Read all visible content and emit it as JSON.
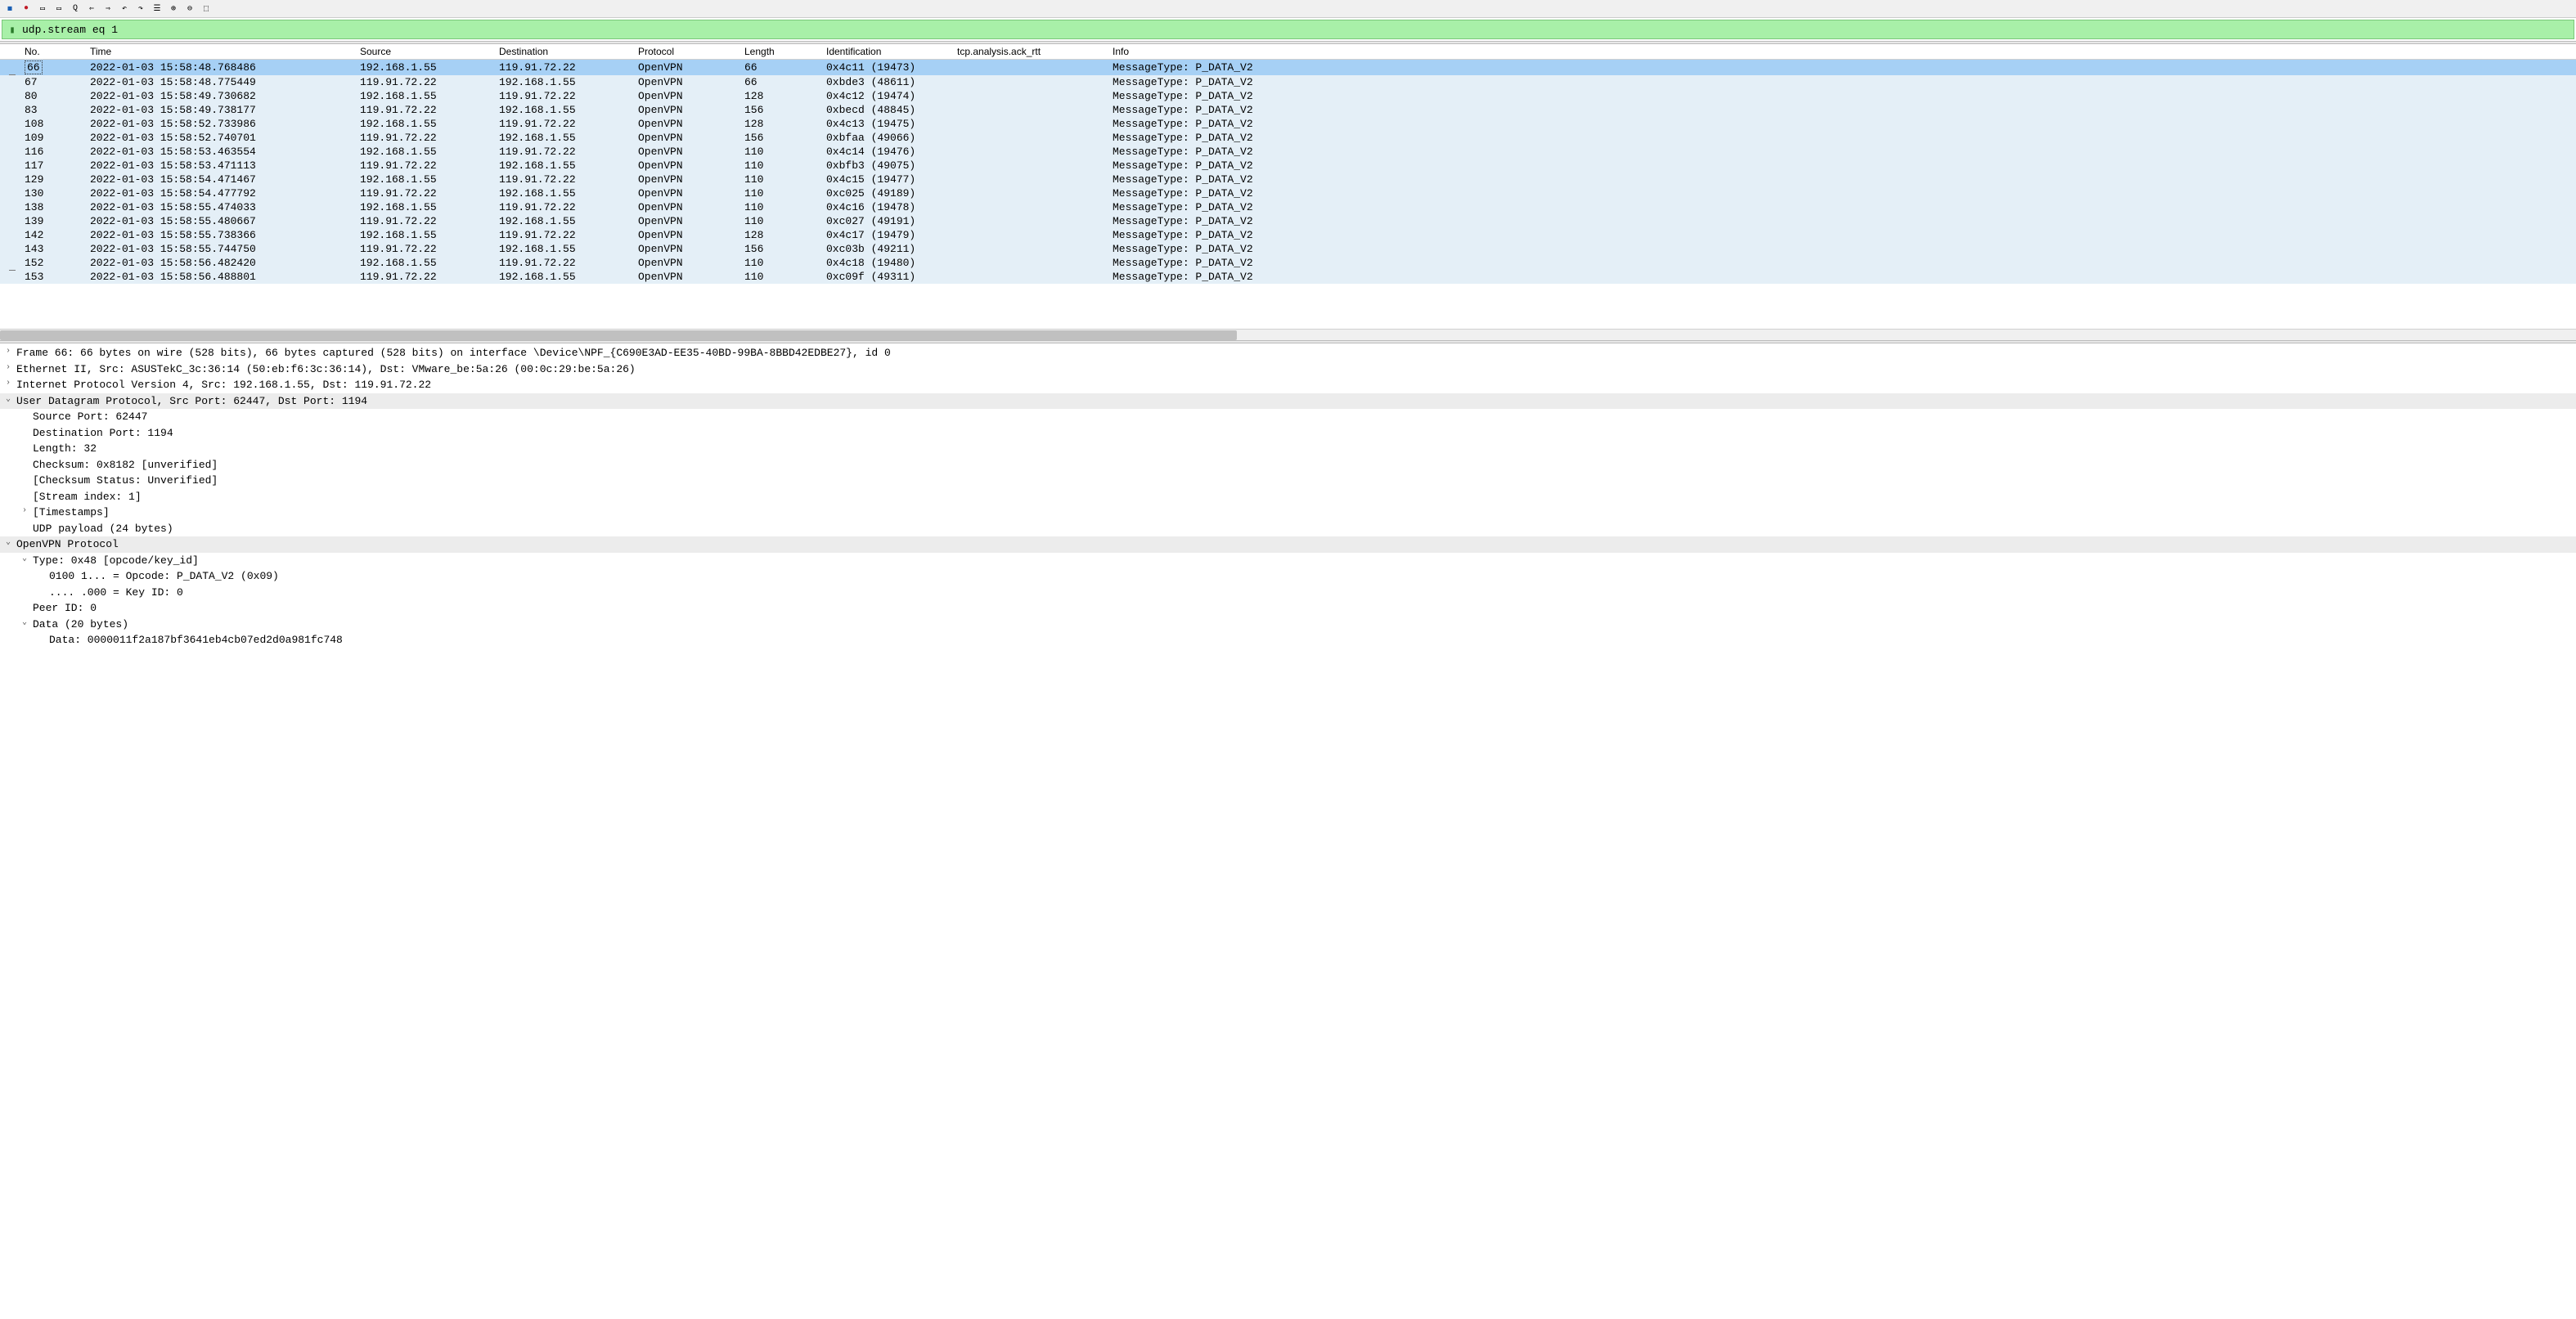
{
  "filter": {
    "value": "udp.stream eq 1"
  },
  "columns": {
    "no": "No.",
    "time": "Time",
    "source": "Source",
    "destination": "Destination",
    "protocol": "Protocol",
    "length": "Length",
    "identification": "Identification",
    "ack_rtt": "tcp.analysis.ack_rtt",
    "info": "Info"
  },
  "packets": [
    {
      "no": "66",
      "time": "2022-01-03 15:58:48.768486",
      "src": "192.168.1.55",
      "dst": "119.91.72.22",
      "proto": "OpenVPN",
      "len": "66",
      "id": "0x4c11 (19473)",
      "rtt": "",
      "info": "MessageType: P_DATA_V2",
      "selected": true
    },
    {
      "no": "67",
      "time": "2022-01-03 15:58:48.775449",
      "src": "119.91.72.22",
      "dst": "192.168.1.55",
      "proto": "OpenVPN",
      "len": "66",
      "id": "0xbde3 (48611)",
      "rtt": "",
      "info": "MessageType: P_DATA_V2"
    },
    {
      "no": "80",
      "time": "2022-01-03 15:58:49.730682",
      "src": "192.168.1.55",
      "dst": "119.91.72.22",
      "proto": "OpenVPN",
      "len": "128",
      "id": "0x4c12 (19474)",
      "rtt": "",
      "info": "MessageType: P_DATA_V2"
    },
    {
      "no": "83",
      "time": "2022-01-03 15:58:49.738177",
      "src": "119.91.72.22",
      "dst": "192.168.1.55",
      "proto": "OpenVPN",
      "len": "156",
      "id": "0xbecd (48845)",
      "rtt": "",
      "info": "MessageType: P_DATA_V2"
    },
    {
      "no": "108",
      "time": "2022-01-03 15:58:52.733986",
      "src": "192.168.1.55",
      "dst": "119.91.72.22",
      "proto": "OpenVPN",
      "len": "128",
      "id": "0x4c13 (19475)",
      "rtt": "",
      "info": "MessageType: P_DATA_V2"
    },
    {
      "no": "109",
      "time": "2022-01-03 15:58:52.740701",
      "src": "119.91.72.22",
      "dst": "192.168.1.55",
      "proto": "OpenVPN",
      "len": "156",
      "id": "0xbfaa (49066)",
      "rtt": "",
      "info": "MessageType: P_DATA_V2"
    },
    {
      "no": "116",
      "time": "2022-01-03 15:58:53.463554",
      "src": "192.168.1.55",
      "dst": "119.91.72.22",
      "proto": "OpenVPN",
      "len": "110",
      "id": "0x4c14 (19476)",
      "rtt": "",
      "info": "MessageType: P_DATA_V2"
    },
    {
      "no": "117",
      "time": "2022-01-03 15:58:53.471113",
      "src": "119.91.72.22",
      "dst": "192.168.1.55",
      "proto": "OpenVPN",
      "len": "110",
      "id": "0xbfb3 (49075)",
      "rtt": "",
      "info": "MessageType: P_DATA_V2"
    },
    {
      "no": "129",
      "time": "2022-01-03 15:58:54.471467",
      "src": "192.168.1.55",
      "dst": "119.91.72.22",
      "proto": "OpenVPN",
      "len": "110",
      "id": "0x4c15 (19477)",
      "rtt": "",
      "info": "MessageType: P_DATA_V2"
    },
    {
      "no": "130",
      "time": "2022-01-03 15:58:54.477792",
      "src": "119.91.72.22",
      "dst": "192.168.1.55",
      "proto": "OpenVPN",
      "len": "110",
      "id": "0xc025 (49189)",
      "rtt": "",
      "info": "MessageType: P_DATA_V2"
    },
    {
      "no": "138",
      "time": "2022-01-03 15:58:55.474033",
      "src": "192.168.1.55",
      "dst": "119.91.72.22",
      "proto": "OpenVPN",
      "len": "110",
      "id": "0x4c16 (19478)",
      "rtt": "",
      "info": "MessageType: P_DATA_V2"
    },
    {
      "no": "139",
      "time": "2022-01-03 15:58:55.480667",
      "src": "119.91.72.22",
      "dst": "192.168.1.55",
      "proto": "OpenVPN",
      "len": "110",
      "id": "0xc027 (49191)",
      "rtt": "",
      "info": "MessageType: P_DATA_V2"
    },
    {
      "no": "142",
      "time": "2022-01-03 15:58:55.738366",
      "src": "192.168.1.55",
      "dst": "119.91.72.22",
      "proto": "OpenVPN",
      "len": "128",
      "id": "0x4c17 (19479)",
      "rtt": "",
      "info": "MessageType: P_DATA_V2"
    },
    {
      "no": "143",
      "time": "2022-01-03 15:58:55.744750",
      "src": "119.91.72.22",
      "dst": "192.168.1.55",
      "proto": "OpenVPN",
      "len": "156",
      "id": "0xc03b (49211)",
      "rtt": "",
      "info": "MessageType: P_DATA_V2"
    },
    {
      "no": "152",
      "time": "2022-01-03 15:58:56.482420",
      "src": "192.168.1.55",
      "dst": "119.91.72.22",
      "proto": "OpenVPN",
      "len": "110",
      "id": "0x4c18 (19480)",
      "rtt": "",
      "info": "MessageType: P_DATA_V2"
    },
    {
      "no": "153",
      "time": "2022-01-03 15:58:56.488801",
      "src": "119.91.72.22",
      "dst": "192.168.1.55",
      "proto": "OpenVPN",
      "len": "110",
      "id": "0xc09f (49311)",
      "rtt": "",
      "info": "MessageType: P_DATA_V2"
    }
  ],
  "details": {
    "frame": "Frame 66: 66 bytes on wire (528 bits), 66 bytes captured (528 bits) on interface \\Device\\NPF_{C690E3AD-EE35-40BD-99BA-8BBD42EDBE27}, id 0",
    "eth": "Ethernet II, Src: ASUSTekC_3c:36:14 (50:eb:f6:3c:36:14), Dst: VMware_be:5a:26 (00:0c:29:be:5a:26)",
    "ip": "Internet Protocol Version 4, Src: 192.168.1.55, Dst: 119.91.72.22",
    "udp_header": "User Datagram Protocol, Src Port: 62447, Dst Port: 1194",
    "udp": {
      "src_port": "Source Port: 62447",
      "dst_port": "Destination Port: 1194",
      "length": "Length: 32",
      "checksum": "Checksum: 0x8182 [unverified]",
      "checksum_status": "[Checksum Status: Unverified]",
      "stream": "[Stream index: 1]",
      "timestamps": "[Timestamps]",
      "payload": "UDP payload (24 bytes)"
    },
    "openvpn_header": "OpenVPN Protocol",
    "openvpn": {
      "type": "Type: 0x48 [opcode/key_id]",
      "opcode": "0100 1... = Opcode: P_DATA_V2 (0x09)",
      "keyid": ".... .000 = Key ID: 0",
      "peerid": "Peer ID: 0",
      "data_header": "Data (20 bytes)",
      "data": "Data: 0000011f2a187bf3641eb4cb07ed2d0a981fc748"
    }
  }
}
